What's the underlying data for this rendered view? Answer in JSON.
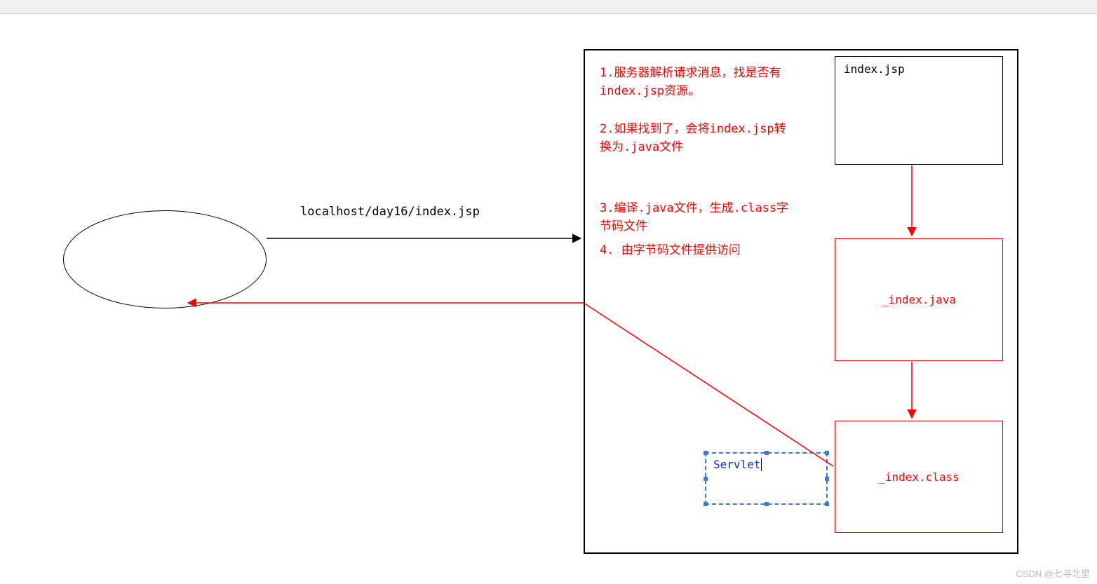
{
  "request_url": "localhost/day16/index.jsp",
  "steps": {
    "s1": "1.服务器解析请求消息，找是否有index.jsp资源。",
    "s2": "2.如果找到了，会将index.jsp转换为.java文件",
    "s3": "3.编译.java文件，生成.class字节码文件",
    "s4": "4. 由字节码文件提供访问"
  },
  "files": {
    "jsp": "index.jsp",
    "java": "_index.java",
    "klass": "_index.class"
  },
  "servlet_label": "Servlet",
  "watermark": "CSDN @七寻北里"
}
